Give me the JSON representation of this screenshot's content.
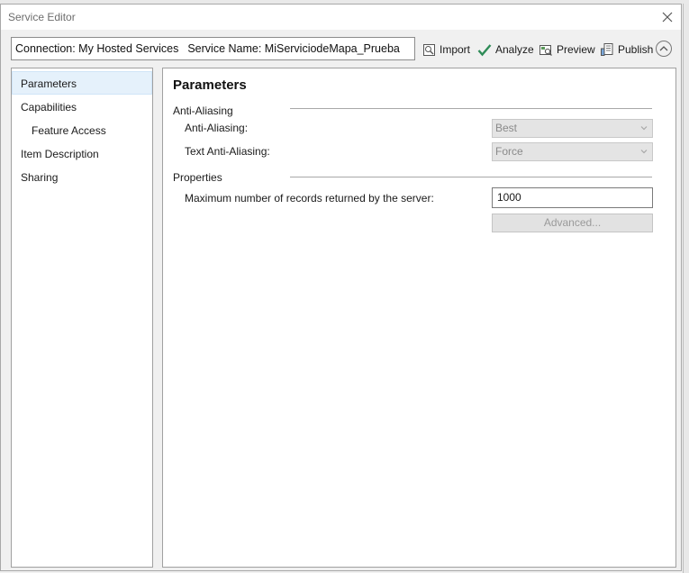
{
  "window": {
    "title": "Service Editor"
  },
  "connection": {
    "connection_text": "Connection: My Hosted Services",
    "service_text": "Service Name: MiServiciodeMapa_Prueba"
  },
  "toolbar": {
    "import_label": "Import",
    "analyze_label": "Analyze",
    "preview_label": "Preview",
    "publish_label": "Publish"
  },
  "nav": {
    "items": [
      {
        "label": "Parameters",
        "selected": true
      },
      {
        "label": "Capabilities"
      },
      {
        "label": "Feature Access"
      },
      {
        "label": "Item Description"
      },
      {
        "label": "Sharing"
      }
    ]
  },
  "content": {
    "title": "Parameters",
    "anti_aliasing": {
      "section_label": "Anti-Aliasing",
      "anti_aliasing_label": "Anti-Aliasing:",
      "anti_aliasing_value": "Best",
      "text_anti_aliasing_label": "Text Anti-Aliasing:",
      "text_anti_aliasing_value": "Force"
    },
    "properties": {
      "section_label": "Properties",
      "max_records_label": "Maximum number of records returned by the server:",
      "max_records_value": "1000",
      "advanced_label": "Advanced..."
    }
  },
  "colors": {
    "selection_bg": "#e5f1fb",
    "analyze_check": "#2e8b57",
    "disabled_text": "#8a8a8a"
  },
  "icons": [
    "close-icon",
    "import-icon",
    "check-icon",
    "preview-icon",
    "publish-icon",
    "chevron-up-icon",
    "chevron-down-icon"
  ]
}
